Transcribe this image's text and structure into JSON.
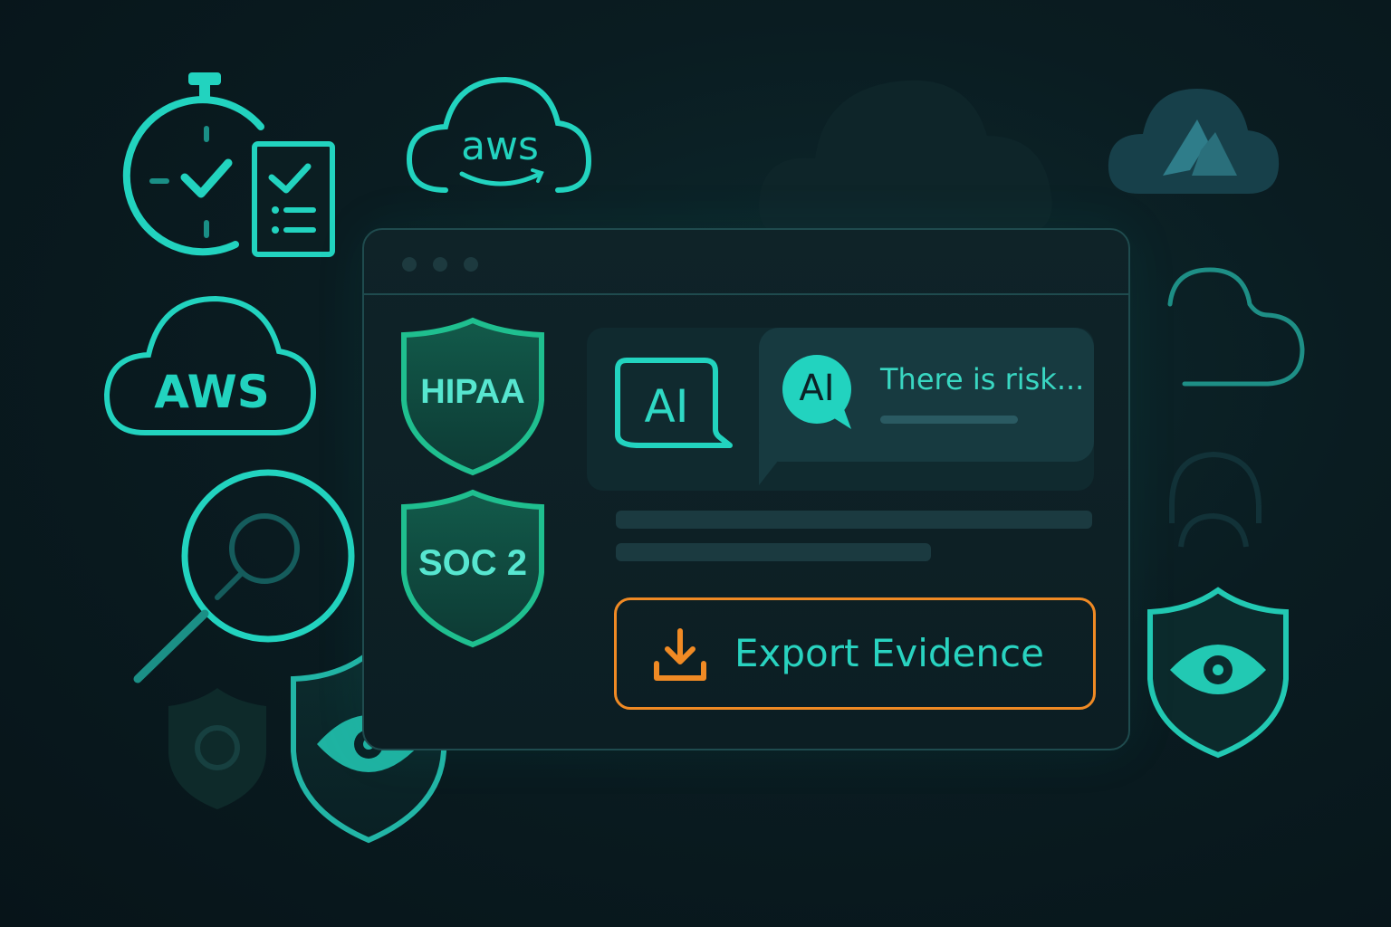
{
  "colors": {
    "accent": "#22d3bf",
    "accent_green": "#1fbf8f",
    "button_border": "#f08a24",
    "background": "#0a1c21",
    "panel": "#102a2f"
  },
  "icons": {
    "stopwatch": "stopwatch-icon",
    "checklist": "checklist-icon",
    "aws_cloud_small": "aws-cloud-icon",
    "aws_cloud_large": "aws-cloud-icon",
    "azure_cloud": "azure-cloud-icon",
    "magnifier": "magnifier-icon",
    "shield_eye": "shield-eye-icon",
    "download": "download-icon"
  },
  "logos": {
    "aws_top": "aws",
    "aws_left": "AWS"
  },
  "badges": {
    "hipaa": "HIPAA",
    "soc2": "SOC 2"
  },
  "ai": {
    "icon_label": "AI",
    "avatar_label": "AI",
    "message": "There is risk..."
  },
  "actions": {
    "export_label": "Export Evidence"
  }
}
